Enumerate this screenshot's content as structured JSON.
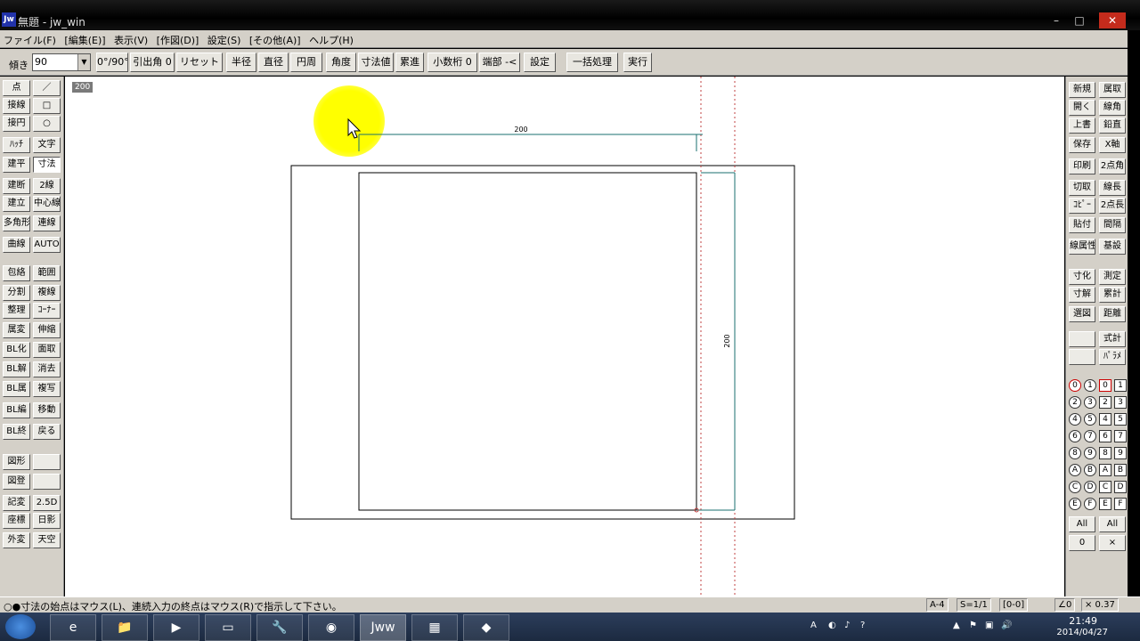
{
  "window": {
    "app_icon": "Jw",
    "title": "無題 - jw_win",
    "minimize": "–",
    "maximize": "□",
    "close": "✕"
  },
  "menu": [
    "ファイル(F)",
    "[編集(E)]",
    "表示(V)",
    "[作図(D)]",
    "設定(S)",
    "[その他(A)]",
    "ヘルプ(H)"
  ],
  "toolbar": {
    "angle_label": "傾き",
    "angle_value": "90",
    "buttons": [
      "0°/90°",
      "引出角 0",
      "リセット",
      "半径",
      "直径",
      "円周",
      "角度",
      "寸法値",
      "累進",
      "小数桁 0",
      "端部 -<",
      "設定",
      "一括処理",
      "実行"
    ]
  },
  "left_tools": [
    [
      "点",
      "／"
    ],
    [
      "接線",
      "□"
    ],
    [
      "接円",
      "○"
    ],
    [
      "ﾊｯﾁ",
      "文字"
    ],
    [
      "建平",
      "寸法"
    ],
    [
      "建断",
      "2線"
    ],
    [
      "建立",
      "中心線"
    ],
    [
      "多角形",
      "連線"
    ],
    [
      "曲線",
      "AUTO"
    ],
    [
      "包絡",
      "範囲"
    ],
    [
      "分割",
      "複線"
    ],
    [
      "整理",
      "ｺｰﾅｰ"
    ],
    [
      "属変",
      "伸縮"
    ],
    [
      "BL化",
      "面取"
    ],
    [
      "BL解",
      "消去"
    ],
    [
      "BL属",
      "複写"
    ],
    [
      "BL編",
      "移動"
    ],
    [
      "BL終",
      "戻る"
    ],
    [
      "図形",
      ""
    ],
    [
      "図登",
      ""
    ],
    [
      "記変",
      "2.5D"
    ],
    [
      "座標",
      "日影"
    ],
    [
      "外変",
      "天空"
    ]
  ],
  "right_tools": [
    [
      "新規",
      "属取"
    ],
    [
      "開く",
      "線角"
    ],
    [
      "上書",
      "鉛直"
    ],
    [
      "保存",
      "X軸"
    ],
    [
      "印刷",
      "2点角"
    ],
    [
      "切取",
      "線長"
    ],
    [
      "ｺﾋﾟｰ",
      "2点長"
    ],
    [
      "貼付",
      "間隔"
    ],
    [
      "線属性",
      "基設"
    ],
    [
      "寸化",
      "測定"
    ],
    [
      "寸解",
      "累計"
    ],
    [
      "選図",
      "距離"
    ],
    [
      "",
      "式計"
    ],
    [
      "",
      "ﾊﾟﾗﾒ"
    ]
  ],
  "layer_groups": [
    "0",
    "1",
    "2",
    "3",
    "4",
    "5",
    "6",
    "7",
    "8",
    "9",
    "A",
    "B",
    "C",
    "D",
    "E",
    "F"
  ],
  "layers": [
    "0",
    "1",
    "2",
    "3",
    "4",
    "5",
    "6",
    "7",
    "8",
    "9",
    "A",
    "B",
    "C",
    "D",
    "E",
    "F"
  ],
  "layer_all": [
    "All",
    "All"
  ],
  "layer_misc": [
    "0",
    "×"
  ],
  "canvas": {
    "scale_tag": "200",
    "dim_top": "200",
    "dim_right": "200"
  },
  "status": {
    "message": "○●寸法の始点はマウス(L)、連続入力の終点はマウス(R)で指示して下さい。",
    "paper": "A-4",
    "scale": "S=1/1",
    "layer": "[0-0]",
    "angle": "∠0",
    "zoom": "× 0.37"
  },
  "taskbar": {
    "time": "21:49",
    "date": "2014/04/27",
    "tasks": [
      "e",
      "📁",
      "▶",
      "▭",
      "🔧",
      "◉",
      "Jww",
      "▦",
      "◆"
    ],
    "tray": [
      "A",
      "◐",
      "♪",
      "?",
      "▲",
      "⚑",
      "▣",
      "🔊"
    ]
  },
  "colors": {
    "panel": "#d4d0c8",
    "dim_line": "#1a6f6f",
    "guide_line": "#c04040",
    "highlight": "#ffff00"
  }
}
